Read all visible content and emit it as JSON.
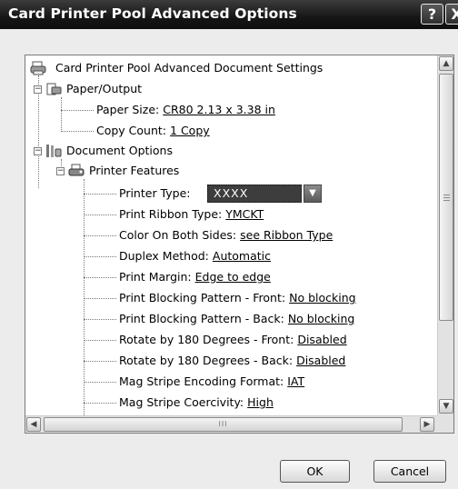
{
  "window": {
    "title": "Card Printer Pool Advanced Options",
    "help_label": "?",
    "close_label": "X"
  },
  "tree": {
    "root_label": "Card Printer Pool Advanced Document Settings",
    "paper_output": {
      "label": "Paper/Output",
      "paper_size": {
        "name": "Paper Size:",
        "value": "CR80 2.13 x 3.38 in"
      },
      "copy_count": {
        "name": "Copy Count:",
        "value": "1 Copy"
      }
    },
    "document_options": {
      "label": "Document Options",
      "printer_features": {
        "label": "Printer Features",
        "printer_type": {
          "name": "Printer Type:",
          "value": "XXXX"
        },
        "items": [
          {
            "name": "Print Ribbon Type:",
            "value": "YMCKT"
          },
          {
            "name": "Color On Both Sides:",
            "value": "see Ribbon Type"
          },
          {
            "name": "Duplex Method:",
            "value": "Automatic"
          },
          {
            "name": "Print Margin:",
            "value": "Edge to edge"
          },
          {
            "name": "Print Blocking Pattern - Front:",
            "value": "No blocking"
          },
          {
            "name": "Print Blocking Pattern - Back:",
            "value": "No blocking"
          },
          {
            "name": "Rotate by 180 Degrees - Front:",
            "value": "Disabled"
          },
          {
            "name": "Rotate by 180 Degrees - Back:",
            "value": "Disabled"
          },
          {
            "name": "Mag Stripe Encoding Format:",
            "value": "IAT"
          },
          {
            "name": "Mag Stripe Coercivity:",
            "value": "High"
          }
        ]
      }
    }
  },
  "scrollbars": {
    "up_arrow": "▲",
    "down_arrow": "▼",
    "left_arrow": "◀",
    "right_arrow": "▶",
    "h_grip": "III"
  },
  "buttons": {
    "ok_label": "OK",
    "cancel_label": "Cancel"
  }
}
